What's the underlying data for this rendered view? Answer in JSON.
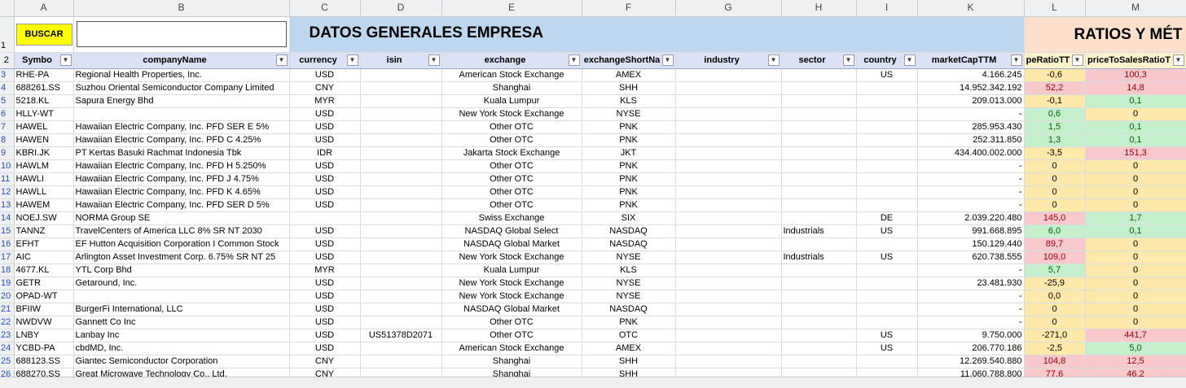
{
  "columns": [
    "A",
    "B",
    "C",
    "D",
    "E",
    "F",
    "G",
    "H",
    "I",
    "K",
    "L",
    "M"
  ],
  "banner": {
    "row_number": "1",
    "search_button": "BUSCAR",
    "search_value": "",
    "title": "DATOS GENERALES EMPRESA",
    "ratios_title": "RATIOS Y MÉT"
  },
  "header_row": {
    "row_number": "2",
    "headers": [
      "Symbo",
      "companyName",
      "currency",
      "isin",
      "exchange",
      "exchangeShortNa",
      "industry",
      "sector",
      "country",
      "marketCapTTM",
      "peRatioTT",
      "priceToSalesRatioT"
    ]
  },
  "rows": [
    {
      "n": "3",
      "symbol": "RHE-PA",
      "company": "Regional Health Properties, Inc.",
      "currency": "USD",
      "isin": "",
      "exchange": "American Stock Exchange",
      "short": "AMEX",
      "industry": "",
      "sector": "",
      "country": "US",
      "mcap": "4.166.245",
      "pe": "-0,6",
      "pe_c": "plain",
      "ps": "100,3",
      "ps_c": "red"
    },
    {
      "n": "4",
      "symbol": "688261.SS",
      "company": "Suzhou Oriental Semiconductor Company Limited",
      "currency": "CNY",
      "isin": "",
      "exchange": "Shanghai",
      "short": "SHH",
      "industry": "",
      "sector": "",
      "country": "",
      "mcap": "14.952.342.192",
      "pe": "52,2",
      "pe_c": "red",
      "ps": "14,8",
      "ps_c": "red"
    },
    {
      "n": "5",
      "symbol": "5218.KL",
      "company": "Sapura Energy Bhd",
      "currency": "MYR",
      "isin": "",
      "exchange": "Kuala Lumpur",
      "short": "KLS",
      "industry": "",
      "sector": "",
      "country": "",
      "mcap": "209.013.000",
      "pe": "-0,1",
      "pe_c": "plain",
      "ps": "0,1",
      "ps_c": "green"
    },
    {
      "n": "6",
      "symbol": "HLLY-WT",
      "company": "",
      "currency": "USD",
      "isin": "",
      "exchange": "New York Stock Exchange",
      "short": "NYSE",
      "industry": "",
      "sector": "",
      "country": "",
      "mcap": "-",
      "pe": "0,6",
      "pe_c": "green",
      "ps": "0",
      "ps_c": "plain"
    },
    {
      "n": "7",
      "symbol": "HAWEL",
      "company": "Hawaiian Electric Company, Inc. PFD SER E 5%",
      "currency": "USD",
      "isin": "",
      "exchange": "Other OTC",
      "short": "PNK",
      "industry": "",
      "sector": "",
      "country": "",
      "mcap": "285.953.430",
      "pe": "1,5",
      "pe_c": "green",
      "ps": "0,1",
      "ps_c": "green"
    },
    {
      "n": "8",
      "symbol": "HAWEN",
      "company": "Hawaiian Electric Company, Inc. PFD C 4.25%",
      "currency": "USD",
      "isin": "",
      "exchange": "Other OTC",
      "short": "PNK",
      "industry": "",
      "sector": "",
      "country": "",
      "mcap": "252.311.850",
      "pe": "1,3",
      "pe_c": "green",
      "ps": "0,1",
      "ps_c": "green"
    },
    {
      "n": "9",
      "symbol": "KBRI.JK",
      "company": "PT Kertas Basuki Rachmat Indonesia Tbk",
      "currency": "IDR",
      "isin": "",
      "exchange": "Jakarta Stock Exchange",
      "short": "JKT",
      "industry": "",
      "sector": "",
      "country": "",
      "mcap": "434.400.002.000",
      "pe": "-3,5",
      "pe_c": "plain",
      "ps": "151,3",
      "ps_c": "red"
    },
    {
      "n": "10",
      "symbol": "HAWLM",
      "company": "Hawaiian Electric Company, Inc. PFD H 5.250%",
      "currency": "USD",
      "isin": "",
      "exchange": "Other OTC",
      "short": "PNK",
      "industry": "",
      "sector": "",
      "country": "",
      "mcap": "-",
      "pe": "0",
      "pe_c": "plain",
      "ps": "0",
      "ps_c": "plain"
    },
    {
      "n": "11",
      "symbol": "HAWLI",
      "company": "Hawaiian Electric Company, Inc. PFD J 4.75%",
      "currency": "USD",
      "isin": "",
      "exchange": "Other OTC",
      "short": "PNK",
      "industry": "",
      "sector": "",
      "country": "",
      "mcap": "-",
      "pe": "0",
      "pe_c": "plain",
      "ps": "0",
      "ps_c": "plain"
    },
    {
      "n": "12",
      "symbol": "HAWLL",
      "company": "Hawaiian Electric Company, Inc. PFD K 4.65%",
      "currency": "USD",
      "isin": "",
      "exchange": "Other OTC",
      "short": "PNK",
      "industry": "",
      "sector": "",
      "country": "",
      "mcap": "-",
      "pe": "0",
      "pe_c": "plain",
      "ps": "0",
      "ps_c": "plain"
    },
    {
      "n": "13",
      "symbol": "HAWEM",
      "company": "Hawaiian Electric Company, Inc. PFD SER D 5%",
      "currency": "USD",
      "isin": "",
      "exchange": "Other OTC",
      "short": "PNK",
      "industry": "",
      "sector": "",
      "country": "",
      "mcap": "-",
      "pe": "0",
      "pe_c": "plain",
      "ps": "0",
      "ps_c": "plain"
    },
    {
      "n": "14",
      "symbol": "NOEJ.SW",
      "company": "NORMA Group SE",
      "currency": "",
      "isin": "",
      "exchange": "Swiss Exchange",
      "short": "SIX",
      "industry": "",
      "sector": "",
      "country": "DE",
      "mcap": "2.039.220.480",
      "pe": "145,0",
      "pe_c": "red",
      "ps": "1,7",
      "ps_c": "green"
    },
    {
      "n": "15",
      "symbol": "TANNZ",
      "company": "TravelCenters of America LLC 8% SR NT 2030",
      "currency": "USD",
      "isin": "",
      "exchange": "NASDAQ Global Select",
      "short": "NASDAQ",
      "industry": "",
      "sector": "Industrials",
      "country": "US",
      "mcap": "991.668.895",
      "pe": "6,0",
      "pe_c": "green",
      "ps": "0,1",
      "ps_c": "green"
    },
    {
      "n": "16",
      "symbol": "EFHT",
      "company": "EF Hutton Acquisition Corporation I Common Stock",
      "currency": "USD",
      "isin": "",
      "exchange": "NASDAQ Global Market",
      "short": "NASDAQ",
      "industry": "",
      "sector": "",
      "country": "",
      "mcap": "150.129.440",
      "pe": "89,7",
      "pe_c": "red",
      "ps": "0",
      "ps_c": "plain"
    },
    {
      "n": "17",
      "symbol": "AIC",
      "company": "Arlington Asset Investment Corp. 6.75% SR NT 25",
      "currency": "USD",
      "isin": "",
      "exchange": "New York Stock Exchange",
      "short": "NYSE",
      "industry": "",
      "sector": "Industrials",
      "country": "US",
      "mcap": "620.738.555",
      "pe": "109,0",
      "pe_c": "red",
      "ps": "0",
      "ps_c": "plain"
    },
    {
      "n": "18",
      "symbol": "4677.KL",
      "company": "YTL Corp Bhd",
      "currency": "MYR",
      "isin": "",
      "exchange": "Kuala Lumpur",
      "short": "KLS",
      "industry": "",
      "sector": "",
      "country": "",
      "mcap": "-",
      "pe": "5,7",
      "pe_c": "green",
      "ps": "0",
      "ps_c": "plain"
    },
    {
      "n": "19",
      "symbol": "GETR",
      "company": "Getaround, Inc.",
      "currency": "USD",
      "isin": "",
      "exchange": "New York Stock Exchange",
      "short": "NYSE",
      "industry": "",
      "sector": "",
      "country": "",
      "mcap": "23.481.930",
      "pe": "-25,9",
      "pe_c": "plain",
      "ps": "0",
      "ps_c": "plain"
    },
    {
      "n": "20",
      "symbol": "OPAD-WT",
      "company": "",
      "currency": "USD",
      "isin": "",
      "exchange": "New York Stock Exchange",
      "short": "NYSE",
      "industry": "",
      "sector": "",
      "country": "",
      "mcap": "-",
      "pe": "0,0",
      "pe_c": "plain",
      "ps": "0",
      "ps_c": "plain"
    },
    {
      "n": "21",
      "symbol": "BFIIW",
      "company": "BurgerFi International, LLC",
      "currency": "USD",
      "isin": "",
      "exchange": "NASDAQ Global Market",
      "short": "NASDAQ",
      "industry": "",
      "sector": "",
      "country": "",
      "mcap": "-",
      "pe": "0",
      "pe_c": "plain",
      "ps": "0",
      "ps_c": "plain"
    },
    {
      "n": "22",
      "symbol": "NWDVW",
      "company": "Gannett Co Inc",
      "currency": "USD",
      "isin": "",
      "exchange": "Other OTC",
      "short": "PNK",
      "industry": "",
      "sector": "",
      "country": "",
      "mcap": "-",
      "pe": "0",
      "pe_c": "plain",
      "ps": "0",
      "ps_c": "plain"
    },
    {
      "n": "23",
      "symbol": "LNBY",
      "company": "Lanbay Inc",
      "currency": "USD",
      "isin": "US51378D2071",
      "exchange": "Other OTC",
      "short": "OTC",
      "industry": "",
      "sector": "",
      "country": "US",
      "mcap": "9.750.000",
      "pe": "-271,0",
      "pe_c": "plain",
      "ps": "441,7",
      "ps_c": "red"
    },
    {
      "n": "24",
      "symbol": "YCBD-PA",
      "company": "cbdMD, Inc.",
      "currency": "USD",
      "isin": "",
      "exchange": "American Stock Exchange",
      "short": "AMEX",
      "industry": "",
      "sector": "",
      "country": "US",
      "mcap": "206.770.186",
      "pe": "-2,5",
      "pe_c": "plain",
      "ps": "5,0",
      "ps_c": "green"
    },
    {
      "n": "25",
      "symbol": "688123.SS",
      "company": "Giantec Semiconductor Corporation",
      "currency": "CNY",
      "isin": "",
      "exchange": "Shanghai",
      "short": "SHH",
      "industry": "",
      "sector": "",
      "country": "",
      "mcap": "12.269.540.880",
      "pe": "104,8",
      "pe_c": "red",
      "ps": "12,5",
      "ps_c": "red"
    },
    {
      "n": "26",
      "symbol": "688270.SS",
      "company": "Great Microwave Technology Co., Ltd.",
      "currency": "CNY",
      "isin": "",
      "exchange": "Shanghai",
      "short": "SHH",
      "industry": "",
      "sector": "",
      "country": "",
      "mcap": "11.060.788.800",
      "pe": "77,6",
      "pe_c": "red",
      "ps": "46,2",
      "ps_c": "red"
    }
  ],
  "colors": {
    "banner_blue": "#bed6ee",
    "ratios_peach": "#fde0cc",
    "button_yellow": "#ffff00",
    "ratio_red": "#f7c8cc",
    "ratio_green": "#c6efce",
    "ratio_yellow": "#fde9a9"
  }
}
